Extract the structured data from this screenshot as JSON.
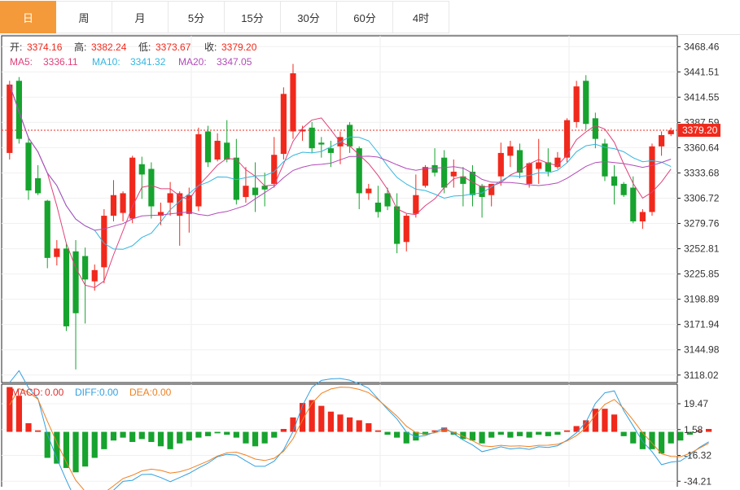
{
  "tabs": [
    "日",
    "周",
    "月",
    "5分",
    "15分",
    "30分",
    "60分",
    "4时"
  ],
  "active_tab": 0,
  "ohlc": {
    "open_label": "开:",
    "open": "3374.16",
    "high_label": "高:",
    "high": "3382.24",
    "low_label": "低:",
    "low": "3373.67",
    "close_label": "收:",
    "close": "3379.20"
  },
  "ma": {
    "ma5_label": "MA5:",
    "ma5": "3336.11",
    "ma10_label": "MA10:",
    "ma10": "3341.32",
    "ma20_label": "MA20:",
    "ma20": "3347.05"
  },
  "macd": {
    "macd_label": "MACD:",
    "macd": "0.00",
    "diff_label": "DIFF:",
    "diff": "0.00",
    "dea_label": "DEA:",
    "dea": "0.00"
  },
  "price_badge": "3379.20",
  "colors": {
    "up": "#f0291c",
    "down": "#16a32e",
    "ma5": "#e0407a",
    "ma10": "#33b6e0",
    "ma20": "#b24ab8",
    "dea": "#f08020",
    "accent": "#f59a3a"
  },
  "chart_data": [
    {
      "type": "candlestick",
      "yticks": [
        3468.46,
        3441.51,
        3414.55,
        3387.59,
        3360.64,
        3333.68,
        3306.72,
        3279.76,
        3252.81,
        3225.85,
        3198.89,
        3171.94,
        3144.98,
        3118.02
      ],
      "ylim": [
        3110,
        3480
      ],
      "current_price": 3379.2,
      "candles": [
        [
          3355,
          3432,
          3348,
          3428
        ],
        [
          3432,
          3436,
          3365,
          3370
        ],
        [
          3366,
          3372,
          3305,
          3315
        ],
        [
          3328,
          3342,
          3310,
          3312
        ],
        [
          3304,
          3305,
          3232,
          3243
        ],
        [
          3244,
          3262,
          3235,
          3253
        ],
        [
          3253,
          3258,
          3165,
          3170
        ],
        [
          3250,
          3262,
          3124,
          3184
        ],
        [
          3245,
          3254,
          3173,
          3220
        ],
        [
          3218,
          3236,
          3208,
          3230
        ],
        [
          3233,
          3295,
          3216,
          3288
        ],
        [
          3288,
          3326,
          3282,
          3310
        ],
        [
          3291,
          3314,
          3282,
          3312
        ],
        [
          3285,
          3352,
          3280,
          3350
        ],
        [
          3343,
          3351,
          3306,
          3332
        ],
        [
          3338,
          3345,
          3285,
          3298
        ],
        [
          3288,
          3302,
          3278,
          3292
        ],
        [
          3302,
          3324,
          3288,
          3312
        ],
        [
          3288,
          3314,
          3256,
          3312
        ],
        [
          3290,
          3318,
          3270,
          3310
        ],
        [
          3298,
          3382,
          3293,
          3375
        ],
        [
          3378,
          3384,
          3340,
          3345
        ],
        [
          3348,
          3376,
          3346,
          3368
        ],
        [
          3366,
          3390,
          3345,
          3348
        ],
        [
          3350,
          3370,
          3300,
          3305
        ],
        [
          3308,
          3340,
          3302,
          3320
        ],
        [
          3318,
          3345,
          3292,
          3310
        ],
        [
          3320,
          3334,
          3298,
          3316
        ],
        [
          3322,
          3372,
          3318,
          3353
        ],
        [
          3354,
          3425,
          3348,
          3418
        ],
        [
          3378,
          3450,
          3370,
          3440
        ],
        [
          3378,
          3384,
          3368,
          3380
        ],
        [
          3382,
          3388,
          3355,
          3360
        ],
        [
          3366,
          3372,
          3350,
          3364
        ],
        [
          3360,
          3368,
          3340,
          3355
        ],
        [
          3362,
          3378,
          3343,
          3372
        ],
        [
          3385,
          3388,
          3355,
          3362
        ],
        [
          3360,
          3362,
          3295,
          3312
        ],
        [
          3312,
          3322,
          3305,
          3317
        ],
        [
          3302,
          3320,
          3286,
          3292
        ],
        [
          3312,
          3318,
          3294,
          3298
        ],
        [
          3298,
          3312,
          3248,
          3258
        ],
        [
          3260,
          3290,
          3250,
          3288
        ],
        [
          3290,
          3332,
          3286,
          3310
        ],
        [
          3320,
          3342,
          3318,
          3340
        ],
        [
          3342,
          3360,
          3330,
          3334
        ],
        [
          3350,
          3358,
          3312,
          3318
        ],
        [
          3330,
          3348,
          3318,
          3335
        ],
        [
          3330,
          3340,
          3298,
          3322
        ],
        [
          3335,
          3342,
          3298,
          3310
        ],
        [
          3320,
          3322,
          3286,
          3308
        ],
        [
          3310,
          3322,
          3298,
          3322
        ],
        [
          3330,
          3366,
          3320,
          3355
        ],
        [
          3352,
          3368,
          3340,
          3362
        ],
        [
          3358,
          3365,
          3328,
          3334
        ],
        [
          3322,
          3345,
          3318,
          3344
        ],
        [
          3338,
          3370,
          3322,
          3345
        ],
        [
          3345,
          3360,
          3330,
          3335
        ],
        [
          3340,
          3356,
          3338,
          3350
        ],
        [
          3350,
          3392,
          3345,
          3390
        ],
        [
          3388,
          3432,
          3382,
          3426
        ],
        [
          3432,
          3438,
          3380,
          3386
        ],
        [
          3392,
          3398,
          3360,
          3370
        ],
        [
          3365,
          3370,
          3325,
          3330
        ],
        [
          3330,
          3342,
          3300,
          3320
        ],
        [
          3322,
          3324,
          3308,
          3310
        ],
        [
          3318,
          3330,
          3280,
          3282
        ],
        [
          3282,
          3295,
          3274,
          3292
        ],
        [
          3292,
          3365,
          3288,
          3362
        ],
        [
          3362,
          3378,
          3352,
          3374
        ],
        [
          3375,
          3382,
          3373,
          3379
        ]
      ]
    },
    {
      "type": "bar",
      "name": "MACD",
      "yticks": [
        19.47,
        1.58,
        -16.32,
        -34.21
      ],
      "ylim": [
        -38,
        33
      ],
      "values": [
        31,
        25,
        6,
        1,
        -18,
        -22,
        -25,
        -28,
        -24,
        -18,
        -12,
        -6,
        -4,
        -7,
        -5,
        -7,
        -10,
        -12,
        -8,
        -6,
        -4,
        -3,
        -1,
        -2,
        -4,
        -8,
        -10,
        -8,
        -4,
        2,
        10,
        20,
        22,
        18,
        14,
        12,
        10,
        8,
        6,
        1,
        -2,
        -4,
        -8,
        -6,
        -2,
        1,
        3,
        -2,
        -5,
        -6,
        -8,
        -4,
        -2,
        -4,
        -3,
        -4,
        -2,
        -3,
        -2,
        1,
        4,
        8,
        16,
        16,
        12,
        -3,
        -8,
        -12,
        -12,
        -15,
        -8,
        -6,
        -2,
        1,
        2
      ]
    }
  ]
}
